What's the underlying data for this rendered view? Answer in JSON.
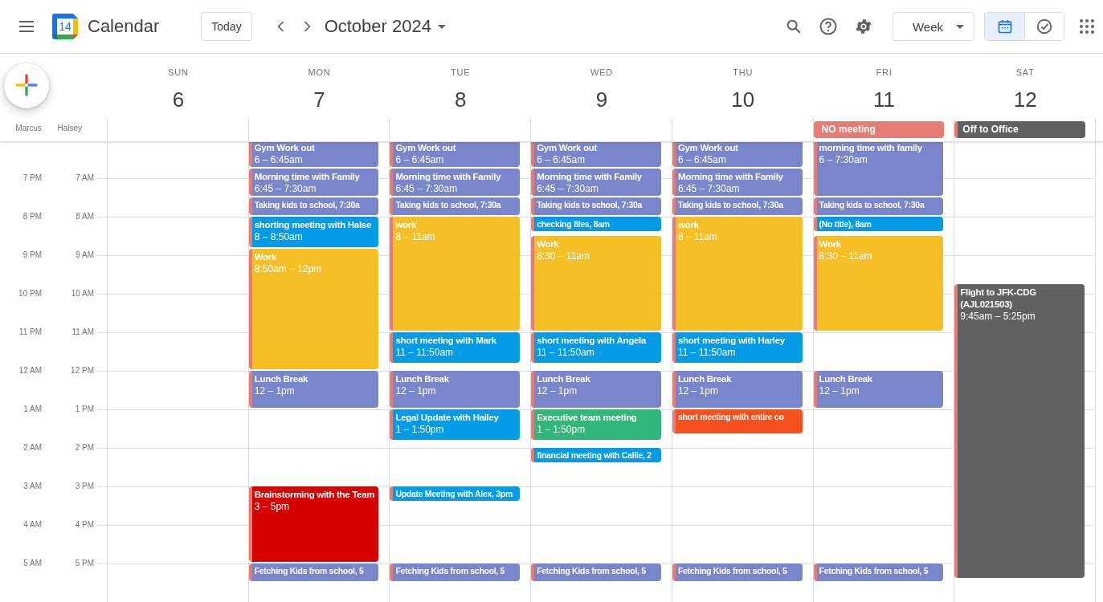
{
  "header": {
    "app_name": "Calendar",
    "logo_text": "14",
    "today_button": "Today",
    "month_title": "October 2024",
    "view_select": "Week",
    "view_toggle": [
      {
        "kind": "calendar",
        "selected": true
      },
      {
        "kind": "tasks",
        "selected": false
      }
    ]
  },
  "people": [
    "Marcus",
    "Halsey"
  ],
  "time_rows": [
    [
      "7 PM",
      "7 AM"
    ],
    [
      "8 PM",
      "8 AM"
    ],
    [
      "9 PM",
      "9 AM"
    ],
    [
      "10 PM",
      "10 AM"
    ],
    [
      "11 PM",
      "11 AM"
    ],
    [
      "12 AM",
      "12 PM"
    ],
    [
      "1 AM",
      "1 PM"
    ],
    [
      "2 AM",
      "2 PM"
    ],
    [
      "3 AM",
      "3 PM"
    ],
    [
      "4 AM",
      "4 PM"
    ],
    [
      "5 AM",
      "5 PM"
    ]
  ],
  "days": [
    {
      "weekday": "SUN",
      "date": "6"
    },
    {
      "weekday": "MON",
      "date": "7",
      "events": [
        {
          "kind": "block",
          "title": "Gym Work out",
          "time": "6 – 6:45am",
          "color": "#7986cb"
        },
        {
          "kind": "block",
          "title": "Morning time with Family",
          "time": "6:45 – 7:30am",
          "color": "#7986cb"
        },
        {
          "kind": "compact",
          "title": "Taking kids to school, 7:30a",
          "color": "#7986cb"
        },
        {
          "kind": "block",
          "title": "shorting meeting with Halse",
          "time": "8 – 8:50am",
          "color": "#039be5"
        },
        {
          "kind": "block",
          "title": "Work",
          "time": "8:50am – 12pm",
          "color": "#f6bf26"
        },
        {
          "kind": "block",
          "title": "Lunch Break",
          "time": "12 – 1pm",
          "color": "#7986cb"
        },
        {
          "kind": "block",
          "title": "Brainstorming with the Team",
          "time": "3 – 5pm",
          "color": "#d50000"
        },
        {
          "kind": "compact",
          "title": "Fetching Kids from school, 5",
          "color": "#7986cb"
        }
      ]
    },
    {
      "weekday": "TUE",
      "date": "8",
      "events": [
        {
          "kind": "block",
          "title": "Gym Work out",
          "time": "6 – 6:45am",
          "color": "#7986cb"
        },
        {
          "kind": "block",
          "title": "Morning time with Family",
          "time": "6:45 – 7:30am",
          "color": "#7986cb"
        },
        {
          "kind": "compact",
          "title": "Taking kids to school, 7:30a",
          "color": "#7986cb"
        },
        {
          "kind": "block",
          "title": "work",
          "time": "8 – 11am",
          "color": "#f6bf26"
        },
        {
          "kind": "block",
          "title": "short meeting with Mark",
          "time": "11 – 11:50am",
          "color": "#039be5"
        },
        {
          "kind": "block",
          "title": "Lunch Break",
          "time": "12 – 1pm",
          "color": "#7986cb"
        },
        {
          "kind": "block",
          "title": "Legal Update with Hailey",
          "time": "1 – 1:50pm",
          "color": "#039be5"
        },
        {
          "kind": "compact",
          "title": "Update Meeting with Alex, 3pm",
          "color": "#039be5"
        },
        {
          "kind": "compact",
          "title": "Fetching Kids from school, 5",
          "color": "#7986cb"
        }
      ]
    },
    {
      "weekday": "WED",
      "date": "9",
      "events": [
        {
          "kind": "block",
          "title": "Gym Work out",
          "time": "6 – 6:45am",
          "color": "#7986cb"
        },
        {
          "kind": "block",
          "title": "Morning time with Family",
          "time": "6:45 – 7:30am",
          "color": "#7986cb"
        },
        {
          "kind": "compact",
          "title": "Taking kids to school, 7:30a",
          "color": "#7986cb"
        },
        {
          "kind": "compact",
          "title": "checking files, 8am",
          "color": "#039be5"
        },
        {
          "kind": "block",
          "title": "Work",
          "time": "8:30 – 11am",
          "color": "#f6bf26"
        },
        {
          "kind": "block",
          "title": "short meeting with Angela",
          "time": "11 – 11:50am",
          "color": "#039be5"
        },
        {
          "kind": "block",
          "title": "Lunch Break",
          "time": "12 – 1pm",
          "color": "#7986cb"
        },
        {
          "kind": "block",
          "title": "Executive team meeting",
          "time": "1 – 1:50pm",
          "color": "#33b679"
        },
        {
          "kind": "compact",
          "title": "financial meeting with Callie, 2",
          "color": "#039be5"
        },
        {
          "kind": "compact",
          "title": "Fetching Kids from school, 5",
          "color": "#7986cb"
        }
      ]
    },
    {
      "weekday": "THU",
      "date": "10",
      "events": [
        {
          "kind": "block",
          "title": "Gym Work out",
          "time": "6 – 6:45am",
          "color": "#7986cb"
        },
        {
          "kind": "block",
          "title": "Morning time with Family",
          "time": "6:45 – 7:30am",
          "color": "#7986cb"
        },
        {
          "kind": "compact",
          "title": "Taking kids to school, 7:30a",
          "color": "#7986cb"
        },
        {
          "kind": "block",
          "title": "work",
          "time": "8 – 11am",
          "color": "#f6bf26"
        },
        {
          "kind": "block",
          "title": "short meeting with Harley",
          "time": "11 – 11:50am",
          "color": "#039be5"
        },
        {
          "kind": "block",
          "title": "Lunch Break",
          "time": "12 – 1pm",
          "color": "#7986cb"
        },
        {
          "kind": "compact",
          "title": "short meeting with entire co",
          "color": "#f4511e"
        },
        {
          "kind": "compact",
          "title": "Fetching Kids from school, 5",
          "color": "#7986cb"
        }
      ]
    },
    {
      "weekday": "FRI",
      "date": "11",
      "all_day": [
        {
          "title": "NO meeting",
          "color": "#e67c73"
        }
      ],
      "events": [
        {
          "kind": "block",
          "title": "morning time with family",
          "time": "6 – 7:30am",
          "color": "#7986cb"
        },
        {
          "kind": "compact",
          "title": "Taking kids to school, 7:30a",
          "color": "#7986cb"
        },
        {
          "kind": "compact",
          "title": "(No title), 8am",
          "color": "#039be5"
        },
        {
          "kind": "block",
          "title": "Work",
          "time": "8:30 – 11am",
          "color": "#f6bf26"
        },
        {
          "kind": "block",
          "title": "Lunch Break",
          "time": "12 – 1pm",
          "color": "#7986cb"
        },
        {
          "kind": "compact",
          "title": "Fetching Kids from school, 5",
          "color": "#7986cb"
        }
      ]
    },
    {
      "weekday": "SAT",
      "date": "12",
      "all_day": [
        {
          "title": "Off to Office",
          "color": "#616161"
        }
      ],
      "events": [
        {
          "kind": "block",
          "title": "Flight to JFK-CDG (AJL021503)",
          "time": "9:45am – 5:25pm",
          "color": "#616161"
        }
      ]
    }
  ]
}
